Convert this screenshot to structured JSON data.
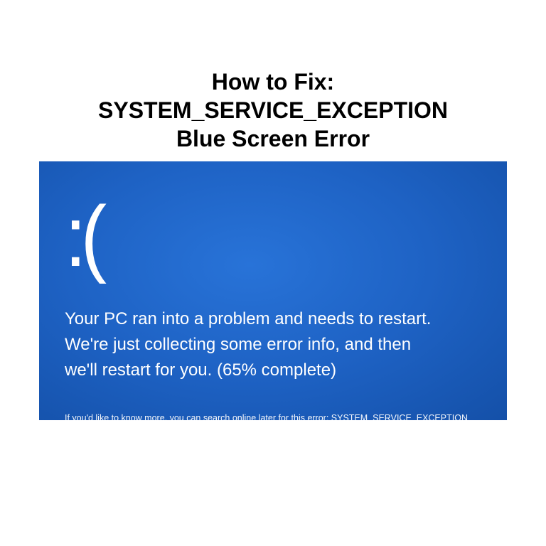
{
  "title": {
    "line1": "How to Fix:",
    "line2": "SYSTEM_SERVICE_EXCEPTION",
    "line3": "Blue Screen Error"
  },
  "bsod": {
    "face": ":(",
    "message_line1": "Your PC ran into a problem and needs to restart.",
    "message_line2": "We're just collecting some error info, and then",
    "message_line3": "we'll restart for you. (65% complete)",
    "progress_percent": 65,
    "footnote": "If you'd like to know more, you can search online later for this error: SYSTEM_SERVICE_EXCEPTION",
    "error_code": "SYSTEM_SERVICE_EXCEPTION"
  },
  "colors": {
    "bsod_bg": "#1e62c4",
    "bsod_text": "#ffffff",
    "page_bg": "#ffffff",
    "title_text": "#000000"
  }
}
